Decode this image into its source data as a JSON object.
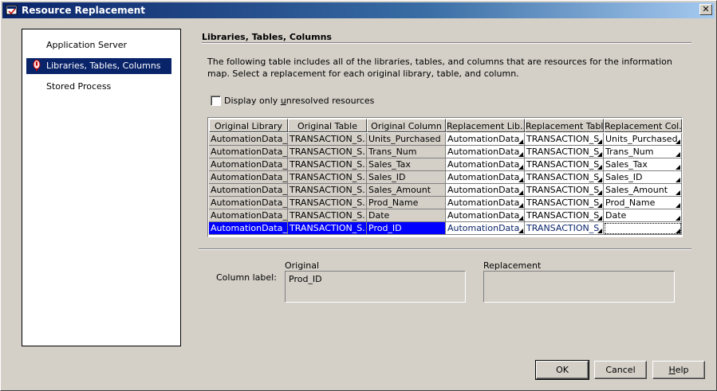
{
  "window": {
    "title": "Resource Replacement",
    "close_glyph": "✕"
  },
  "nav": {
    "items": [
      {
        "label": "Application Server"
      },
      {
        "label": "Libraries, Tables, Columns"
      },
      {
        "label": "Stored Process"
      }
    ]
  },
  "content": {
    "section_title": "Libraries, Tables, Columns",
    "description": "The following table includes all of the libraries, tables, and columns that are resources for the information map. Select a replacement for each original library, table, and column.",
    "checkbox_label_pre": "Display only ",
    "checkbox_label_mnemonic": "u",
    "checkbox_label_post": "nresolved resources"
  },
  "table": {
    "headers": [
      "Original Library",
      "Original Table",
      "Original Column",
      "Replacement Lib...",
      "Replacement Table",
      "Replacement Col..."
    ],
    "rows": [
      [
        "AutomationData_...",
        "TRANSACTION_S...",
        "Units_Purchased",
        "AutomationData_...",
        "TRANSACTION_S...",
        "Units_Purchased"
      ],
      [
        "AutomationData_...",
        "TRANSACTION_S...",
        "Trans_Num",
        "AutomationData_...",
        "TRANSACTION_S...",
        "Trans_Num"
      ],
      [
        "AutomationData_...",
        "TRANSACTION_S...",
        "Sales_Tax",
        "AutomationData_...",
        "TRANSACTION_S...",
        "Sales_Tax"
      ],
      [
        "AutomationData_...",
        "TRANSACTION_S...",
        "Sales_ID",
        "AutomationData_...",
        "TRANSACTION_S...",
        "Sales_ID"
      ],
      [
        "AutomationData_...",
        "TRANSACTION_S...",
        "Sales_Amount",
        "AutomationData_...",
        "TRANSACTION_S...",
        "Sales_Amount"
      ],
      [
        "AutomationData_...",
        "TRANSACTION_S...",
        "Prod_Name",
        "AutomationData_...",
        "TRANSACTION_S...",
        "Prod_Name"
      ],
      [
        "AutomationData_...",
        "TRANSACTION_S...",
        "Date",
        "AutomationData_...",
        "TRANSACTION_S...",
        "Date"
      ],
      [
        "AutomationData_...",
        "TRANSACTION_S...",
        "Prod_ID",
        "AutomationData_...",
        "TRANSACTION_S...",
        ""
      ]
    ]
  },
  "details": {
    "original_header": "Original",
    "replacement_header": "Replacement",
    "column_label": "Column label:",
    "original_value": "Prod_ID",
    "replacement_value": ""
  },
  "buttons": {
    "ok": "OK",
    "cancel": "Cancel",
    "help_mnemonic": "H",
    "help_rest": "elp"
  },
  "colors": {
    "selection": "#0000ff",
    "nav_selected": "#0a246a",
    "warning": "#c00000"
  }
}
